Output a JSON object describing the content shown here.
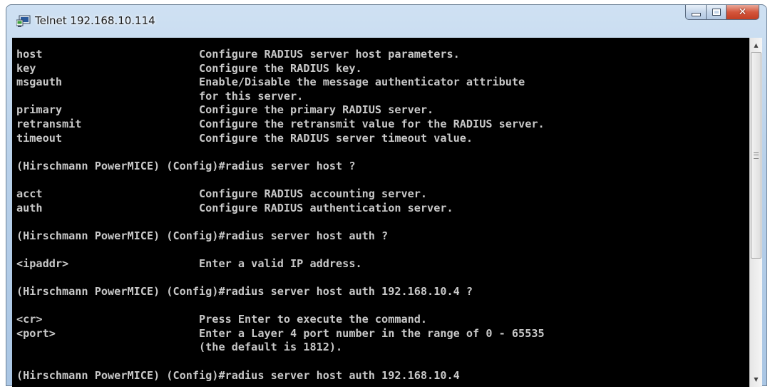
{
  "window": {
    "title": "Telnet 192.168.10.114",
    "icon": "telnet-console-icon",
    "caption_buttons": {
      "minimize": "minimize-icon",
      "maximize": "maximize-icon",
      "close": "✕"
    }
  },
  "console": {
    "lines": [
      "host                        Configure RADIUS server host parameters.",
      "key                         Configure the RADIUS key.",
      "msgauth                     Enable/Disable the message authenticator attribute",
      "                            for this server.",
      "primary                     Configure the primary RADIUS server.",
      "retransmit                  Configure the retransmit value for the RADIUS server.",
      "timeout                     Configure the RADIUS server timeout value.",
      "",
      "(Hirschmann PowerMICE) (Config)#radius server host ?",
      "",
      "acct                        Configure RADIUS accounting server.",
      "auth                        Configure RADIUS authentication server.",
      "",
      "(Hirschmann PowerMICE) (Config)#radius server host auth ?",
      "",
      "<ipaddr>                    Enter a valid IP address.",
      "",
      "(Hirschmann PowerMICE) (Config)#radius server host auth 192.168.10.4 ?",
      "",
      "<cr>                        Press Enter to execute the command.",
      "<port>                      Enter a Layer 4 port number in the range of 0 - 65535",
      "                            (the default is 1812).",
      "",
      "(Hirschmann PowerMICE) (Config)#radius server host auth 192.168.10.4"
    ]
  },
  "scrollbar": {
    "up": "▲",
    "down": "▼"
  }
}
